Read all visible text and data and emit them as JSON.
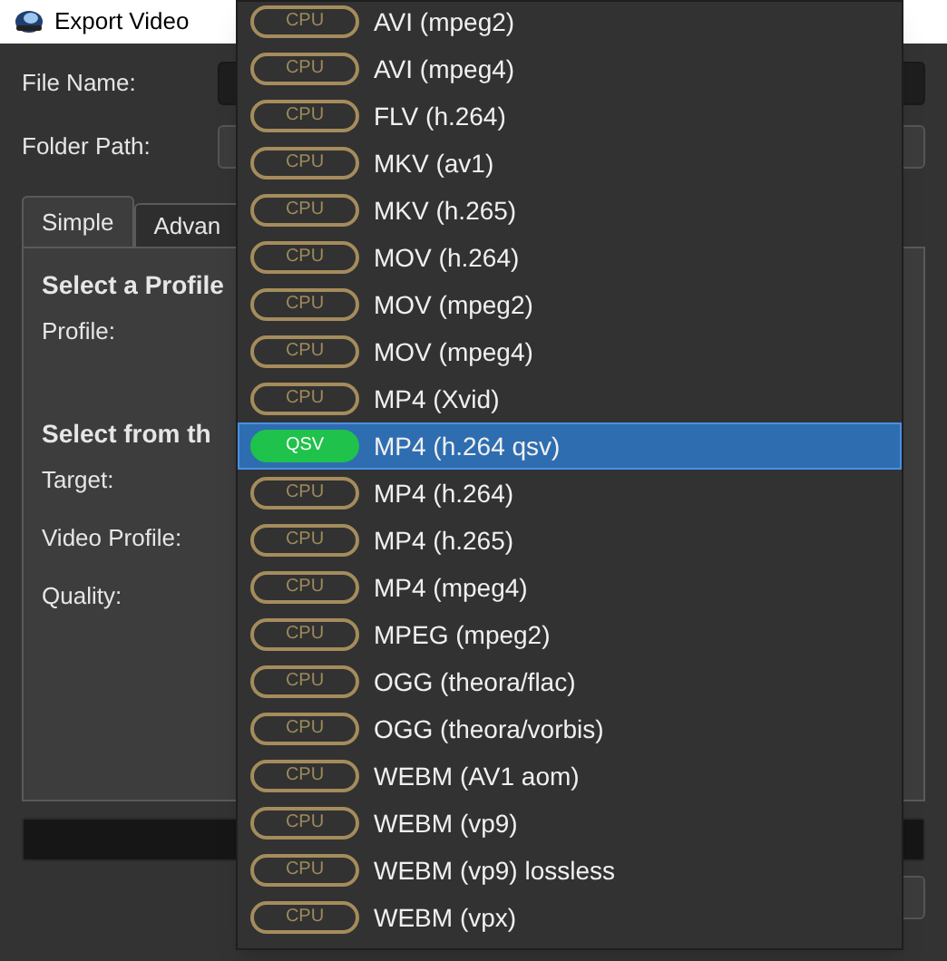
{
  "window": {
    "title": "Export Video"
  },
  "fields": [
    {
      "label": "File Name:",
      "kind": "text"
    },
    {
      "label": "Folder Path:",
      "kind": "button"
    }
  ],
  "progress": {
    "level": 0
  },
  "tabs": [
    {
      "label": "Simple",
      "selected": true
    },
    {
      "label": "Advan",
      "selected": false
    }
  ],
  "panel": {
    "sections": [
      {
        "heading": "Select a Profile",
        "labels": [
          "Profile:"
        ]
      },
      {
        "heading": "Select from th",
        "labels": [
          "Target:",
          "Video Profile:",
          "Quality:"
        ]
      }
    ]
  },
  "formats": [
    {
      "badge": "CPU",
      "kind": "cpu",
      "label": "AVI (mpeg2)",
      "selected": false
    },
    {
      "badge": "CPU",
      "kind": "cpu",
      "label": "AVI (mpeg4)",
      "selected": false
    },
    {
      "badge": "CPU",
      "kind": "cpu",
      "label": "FLV (h.264)",
      "selected": false
    },
    {
      "badge": "CPU",
      "kind": "cpu",
      "label": "MKV (av1)",
      "selected": false
    },
    {
      "badge": "CPU",
      "kind": "cpu",
      "label": "MKV (h.265)",
      "selected": false
    },
    {
      "badge": "CPU",
      "kind": "cpu",
      "label": "MOV (h.264)",
      "selected": false
    },
    {
      "badge": "CPU",
      "kind": "cpu",
      "label": "MOV (mpeg2)",
      "selected": false
    },
    {
      "badge": "CPU",
      "kind": "cpu",
      "label": "MOV (mpeg4)",
      "selected": false
    },
    {
      "badge": "CPU",
      "kind": "cpu",
      "label": "MP4 (Xvid)",
      "selected": false
    },
    {
      "badge": "QSV",
      "kind": "qsv",
      "label": "MP4 (h.264 qsv)",
      "selected": true
    },
    {
      "badge": "CPU",
      "kind": "cpu",
      "label": "MP4 (h.264)",
      "selected": false
    },
    {
      "badge": "CPU",
      "kind": "cpu",
      "label": "MP4 (h.265)",
      "selected": false
    },
    {
      "badge": "CPU",
      "kind": "cpu",
      "label": "MP4 (mpeg4)",
      "selected": false
    },
    {
      "badge": "CPU",
      "kind": "cpu",
      "label": "MPEG (mpeg2)",
      "selected": false
    },
    {
      "badge": "CPU",
      "kind": "cpu",
      "label": "OGG (theora/flac)",
      "selected": false
    },
    {
      "badge": "CPU",
      "kind": "cpu",
      "label": "OGG (theora/vorbis)",
      "selected": false
    },
    {
      "badge": "CPU",
      "kind": "cpu",
      "label": "WEBM (AV1 aom)",
      "selected": false
    },
    {
      "badge": "CPU",
      "kind": "cpu",
      "label": "WEBM (vp9)",
      "selected": false
    },
    {
      "badge": "CPU",
      "kind": "cpu",
      "label": "WEBM (vp9) lossless",
      "selected": false
    },
    {
      "badge": "CPU",
      "kind": "cpu",
      "label": "WEBM (vpx)",
      "selected": false
    }
  ]
}
